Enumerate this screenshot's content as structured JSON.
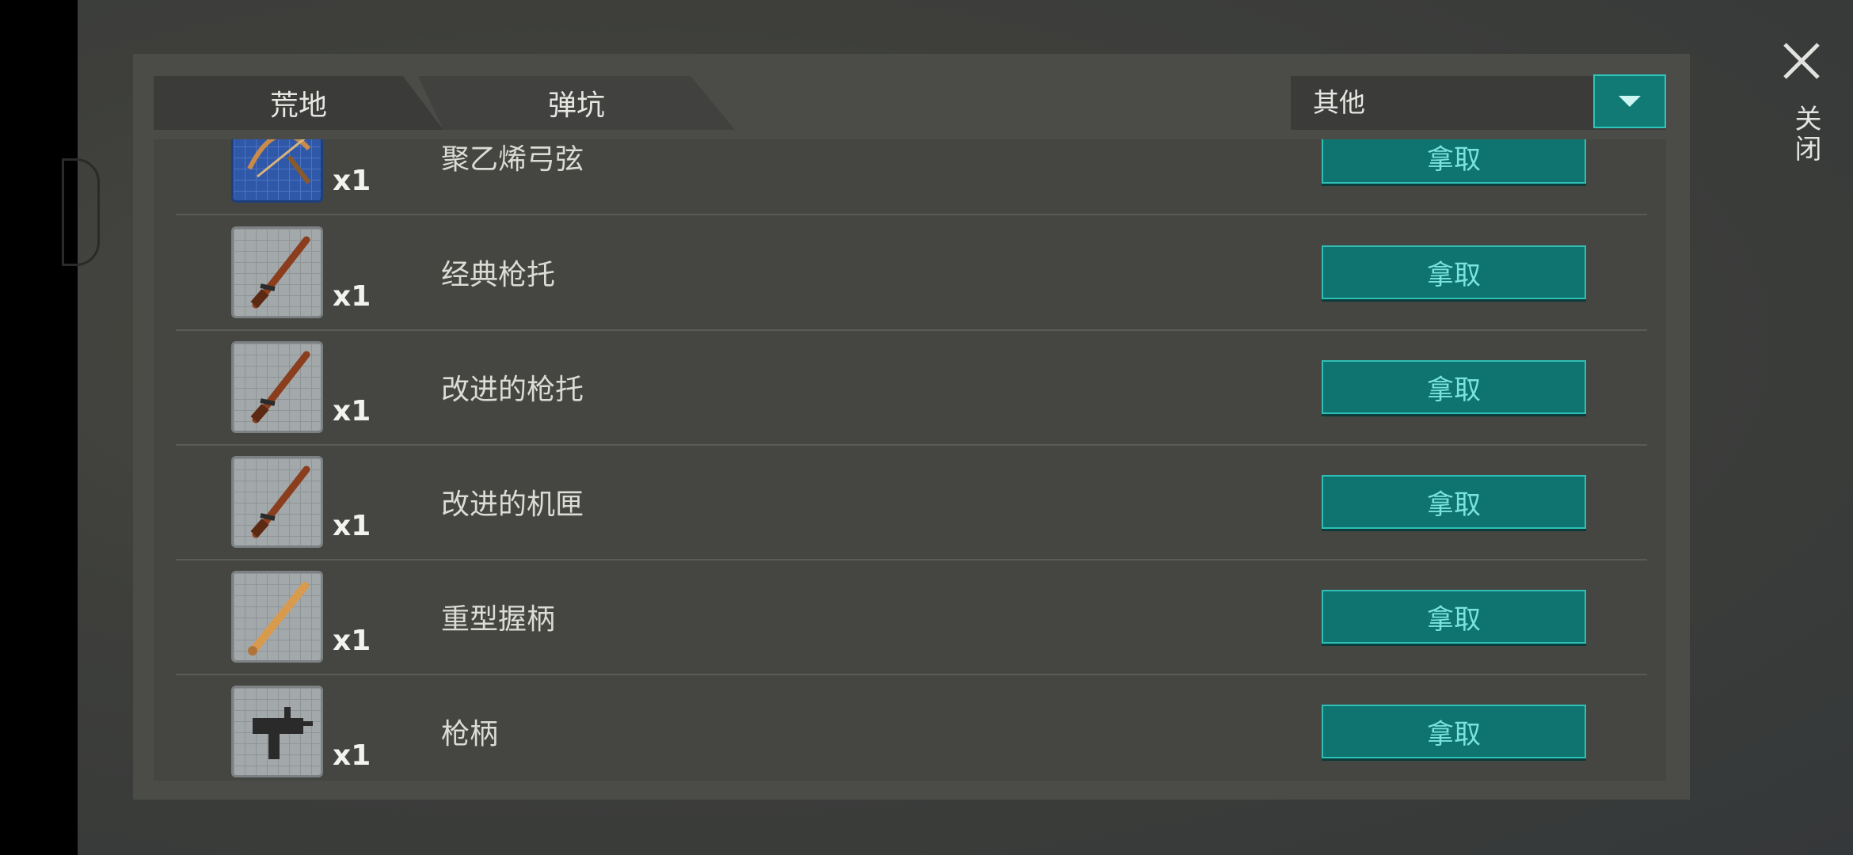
{
  "tabs": [
    {
      "label": "荒地"
    },
    {
      "label": "弹坑"
    }
  ],
  "filter": {
    "selected": "其他"
  },
  "close": {
    "label": "关闭"
  },
  "items": [
    {
      "name": "聚乙烯弓弦",
      "qty": "x1",
      "icon": "crossbow-blueprint-icon",
      "action": "拿取"
    },
    {
      "name": "经典枪托",
      "qty": "x1",
      "icon": "rifle-blueprint-icon",
      "action": "拿取"
    },
    {
      "name": "改进的枪托",
      "qty": "x1",
      "icon": "rifle-blueprint-icon",
      "action": "拿取"
    },
    {
      "name": "改进的机匣",
      "qty": "x1",
      "icon": "rifle-blueprint-icon",
      "action": "拿取"
    },
    {
      "name": "重型握柄",
      "qty": "x1",
      "icon": "bat-blueprint-icon",
      "action": "拿取"
    },
    {
      "name": "枪柄",
      "qty": "x1",
      "icon": "smg-blueprint-icon",
      "action": "拿取"
    }
  ]
}
